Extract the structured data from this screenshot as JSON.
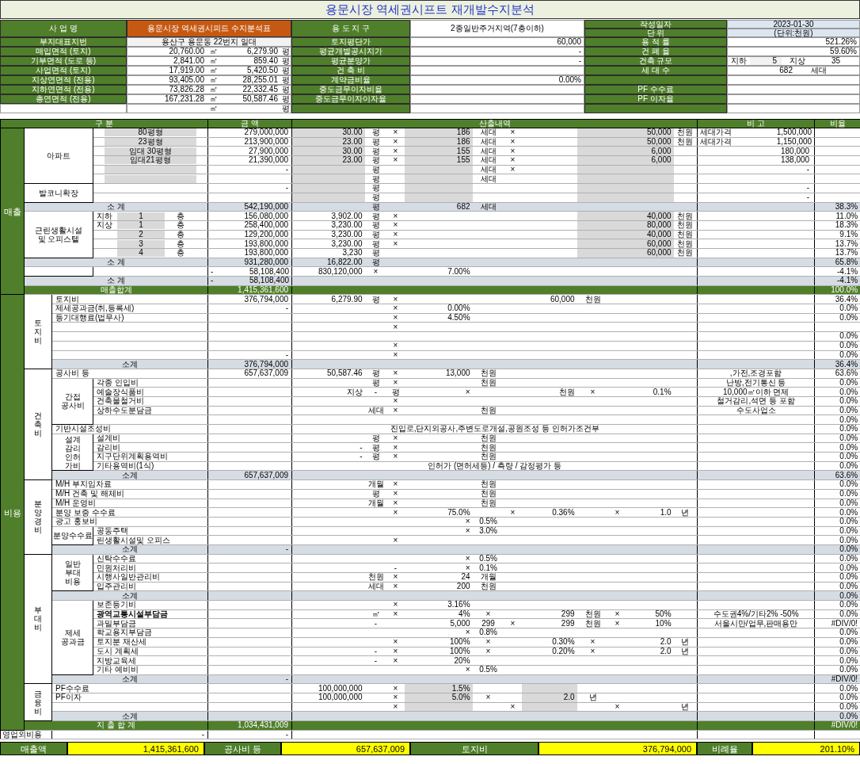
{
  "title": "용문시장 역세권시프트 재개발수지분석",
  "project": {
    "label": "사 업 명",
    "value": "용문시장 역세권시피드 수지분석표"
  },
  "zoning": {
    "label": "용 도 지 구",
    "value": "2종일반주거지역(7층이하)"
  },
  "date": {
    "label": "작성일자",
    "value": "2023-01-30"
  },
  "unit": {
    "label": "단 위",
    "value": "(단위:천원)"
  },
  "info_rows": [
    {
      "label": "부지대표지번",
      "text": "용산구 용문동 22번지 일대",
      "label2": "토지평단가",
      "value2": "60,000",
      "label3": "용 적 률",
      "value3": "521.26%"
    },
    {
      "label": "매입면적 (토지)",
      "sqm": "20,760.00",
      "sqm_unit": "㎡",
      "pyeong": "6,279.90",
      "pyeong_unit": "평",
      "label2": "평균개별공시지가",
      "value2": "-",
      "label3": "건 폐 율",
      "value3": "59.60%"
    },
    {
      "label": "기부면적 (도로 등)",
      "sqm": "2,841.00",
      "sqm_unit": "㎡",
      "pyeong": "859.40",
      "pyeong_unit": "평",
      "label2": "평균분양가",
      "value2": "-",
      "label3": "건축 규모",
      "scale": [
        "지하",
        "5",
        "지상",
        "35"
      ]
    },
    {
      "label": "사업면적 (토지)",
      "sqm": "17,919.00",
      "sqm_unit": "㎡",
      "pyeong": "5,420.50",
      "pyeong_unit": "평",
      "label2": "건 축 비",
      "label3": "세 대 수",
      "value3": "682",
      "value3_unit": "세대"
    },
    {
      "label": "지상연면적 (전용)",
      "sqm": "93,405.00",
      "sqm_unit": "㎡",
      "pyeong": "28,255.01",
      "pyeong_unit": "평",
      "label2": "계약금비율",
      "value2": "0.00%"
    },
    {
      "label": "지하연면적 (전용)",
      "sqm": "73,826.28",
      "sqm_unit": "㎡",
      "pyeong": "22,332.45",
      "pyeong_unit": "평",
      "label2": "중도금무이자비율",
      "label3": "PF 수수료"
    },
    {
      "label": "총연면적 (전용)",
      "sqm": "167,231.28",
      "sqm_unit": "㎡",
      "pyeong": "50,587.46",
      "pyeong_unit": "평",
      "label2": "중도금무이자이자율",
      "label3": "PF 이자율"
    },
    {
      "sqm_unit": "㎡",
      "pyeong_unit": "평"
    }
  ],
  "columns": [
    "구 분",
    "금 액",
    "산출내역",
    "비 고",
    "비율"
  ],
  "sections": [
    {
      "label": "매출",
      "children": [
        {
          "label": "아파트",
          "children": [
            {
              "kind": "unit",
              "label": "80평형",
              "amount": "279,000,000",
              "calc": {
                "column_1": "30.00",
                "column_2": "평",
                "column_3": "×",
                "column_4": "186",
                "column_5": "세대",
                "column_6": "×",
                "column_10": "50,000",
                "column_11": "천원"
              },
              "note": "세대가격",
              "note_value": "1,500,000"
            },
            {
              "kind": "unit",
              "label": "23평형",
              "amount": "213,900,000",
              "calc": {
                "column_1": "23.00",
                "column_2": "평",
                "column_3": "×",
                "column_4": "186",
                "column_5": "세대",
                "column_6": "×",
                "column_10": "50,000",
                "column_11": "천원"
              },
              "note": "세대가격",
              "note_value": "1,150,000"
            },
            {
              "kind": "unit",
              "label": "임대 30평형",
              "amount": "27,900,000",
              "calc": {
                "column_1": "30.00",
                "column_2": "평",
                "column_3": "×",
                "column_4": "155",
                "column_5": "세대",
                "column_6": "×",
                "column_10": "6,000"
              },
              "note_value": "180,000"
            },
            {
              "kind": "unit",
              "label": "임대21평형",
              "amount": "21,390,000",
              "calc": {
                "column_1": "23.00",
                "column_2": "평",
                "column_3": "×",
                "column_4": "155",
                "column_5": "세대",
                "column_6": "×",
                "column_10": "6,000"
              },
              "note_value": "138,000"
            },
            {
              "kind": "unit",
              "amount": "-",
              "calc": {
                "column_2": "평",
                "column_5": "세대",
                "column_6": "×"
              },
              "note_value": "-"
            },
            {
              "kind": "unit",
              "calc": {
                "column_2": "평",
                "column_5": "세대"
              }
            }
          ]
        },
        {
          "label": "발코니확장",
          "children": [
            {
              "kind": "input",
              "amount": "-",
              "calc": {
                "column_2": "평"
              },
              "note_value": "-"
            },
            {
              "kind": "input",
              "calc": {
                "column_2": "평"
              },
              "note_value": "-"
            }
          ]
        },
        {
          "kind": "subtotal",
          "label": "소 계",
          "amount": "542,190,000",
          "calc": {
            "column_2": "평",
            "column_4": "682",
            "column_5": "세대"
          },
          "ratio": "38.3%"
        },
        {
          "label": "근린생활시설\n및 오피스텔",
          "children": [
            {
              "kind": "floor",
              "prefix": "지하",
              "floor": "1",
              "suffix": "층",
              "amount": "156,080,000",
              "calc": {
                "column_1": "3,902.00",
                "column_2": "평",
                "column_3": "×",
                "column_10": "40,000",
                "column_11": "천원"
              },
              "ratio": "11.0%"
            },
            {
              "kind": "floor",
              "prefix": "지상",
              "floor": "1",
              "suffix": "층",
              "amount": "258,400,000",
              "calc": {
                "column_1": "3,230.00",
                "column_2": "평",
                "column_3": "×",
                "column_10": "80,000",
                "column_11": "천원"
              },
              "ratio": "18.3%"
            },
            {
              "kind": "floor",
              "floor": "2",
              "suffix": "층",
              "amount": "129,200,000",
              "calc": {
                "column_1": "3,230.00",
                "column_2": "평",
                "column_3": "×",
                "column_10": "40,000",
                "column_11": "천원"
              },
              "ratio": "9.1%"
            },
            {
              "kind": "floor",
              "floor": "3",
              "suffix": "층",
              "amount": "193,800,000",
              "calc": {
                "column_1": "3,230.00",
                "column_2": "평",
                "column_3": "×",
                "column_10": "60,000",
                "column_11": "천원"
              },
              "ratio": "13.7%"
            },
            {
              "kind": "floor",
              "floor": "4",
              "suffix": "층",
              "amount": "193,800,000",
              "calc": {
                "column_1": "3,230",
                "column_2": "평",
                "column_10": "60,000",
                "column_11": "천원"
              },
              "ratio": "13.7%"
            }
          ]
        },
        {
          "kind": "subtotal",
          "label": "소 계",
          "amount": "931,280,000",
          "calc": {
            "column_1": "16,822.00",
            "column_2": "평"
          },
          "ratio": "65.8%"
        },
        {
          "children": [
            {
              "sign": "-",
              "amount": "58,108,400",
              "calc": {
                "column_1": "830,120,000",
                "column_2": "×",
                "column_4": "7.00%"
              },
              "ratio": "-4.1%"
            }
          ]
        },
        {
          "kind": "subtotal",
          "label": "소 계",
          "sign": "-",
          "amount": "58,108,400",
          "ratio": "-4.1%"
        },
        {
          "kind": "total",
          "label": "매출합계",
          "amount": "1,415,361,600",
          "ratio": "100.0%"
        }
      ]
    },
    {
      "label": "비용",
      "children": [
        {
          "label": "토지비",
          "kind": "vertical",
          "children": [
            {
              "label": "토지비",
              "amount": "376,794,000",
              "calc": {
                "column_1": "6,279.90",
                "column_2": "평",
                "column_3": "×",
                "column_7": "60,000",
                "column_8": "천원"
              },
              "ratio": "36.4%"
            },
            {
              "label": "제세공과금(취,등록세)",
              "amount": "-",
              "calc": {
                "column_3": "×",
                "column_4": "0.00%"
              },
              "ratio": "0.0%"
            },
            {
              "label": "등기대행료(법무사)",
              "calc": {
                "column_3": "×",
                "column_4": "4.50%"
              },
              "ratio": "0.0%"
            },
            {
              "calc": {
                "column_3": "×"
              }
            },
            {
              "ratio": "0.0%"
            },
            {
              "calc": {
                "column_3": "×"
              },
              "ratio": "0.0%"
            },
            {
              "amount": "-",
              "calc": {
                "column_3": "×"
              },
              "ratio": "0.0%"
            },
            {
              "kind": "subtotal",
              "label": "소계",
              "amount": "376,794,000",
              "ratio": "36.4%"
            }
          ]
        },
        {
          "label": "건축비",
          "kind": "vertical",
          "children": [
            {
              "label": "공사비 등",
              "amount": "657,637,009",
              "calc": {
                "column_1": "50,587.46",
                "column_2": "평",
                "column_3": "×",
                "column_4": "13,000",
                "column_5": "천원"
              },
              "note": ",가전,조경포함",
              "ratio": "63.6%"
            },
            {
              "label": "간접\n공사비",
              "children": [
                {
                  "label": "각종 인입비",
                  "calc": {
                    "column_2": "평",
                    "column_3": "×",
                    "column_5": "천원"
                  },
                  "note": "난방,전기통신 등",
                  "ratio": "0.0%"
                },
                {
                  "label": "예술장식품비",
                  "calc": {
                    "column_1": "지상",
                    "column_2": "-",
                    "column_3": "평",
                    "column_4": "×",
                    "column_7": "천원",
                    "column_8": "×",
                    "column_10": "0.1%"
                  },
                  "note": "10,000㎡이하 면제",
                  "ratio": "0.0%"
                },
                {
                  "label": "건축물철거비",
                  "calc": {
                    "column_3": "×"
                  },
                  "note": "철거감리,석면 등 포함",
                  "ratio": "0.0%"
                },
                {
                  "label": "상하수도분담금",
                  "calc": {
                    "column_2": "세대",
                    "column_3": "×",
                    "column_5": "천원"
                  },
                  "note": "수도사업소",
                  "ratio": "0.0%"
                },
                {
                  "ratio": "0.0%"
                }
              ]
            },
            {
              "label": "기반시설조성비",
              "calc_text": "진입로,단지외공사,주변도로개설,공원조성 등 인허가조건부",
              "ratio": "0.0%"
            },
            {
              "label": "설계\n감리\n인허\n가비",
              "children": [
                {
                  "label": "설계비",
                  "calc": {
                    "column_2": "평",
                    "column_3": "×",
                    "column_5": "천원"
                  },
                  "ratio": "0.0%"
                },
                {
                  "label": "감리비",
                  "calc": {
                    "column_1": "-",
                    "column_2": "평",
                    "column_3": "×",
                    "column_5": "천원"
                  },
                  "ratio": "0.0%"
                },
                {
                  "label": "지구단위계획용역비",
                  "calc": {
                    "column_1": "-",
                    "column_2": "평",
                    "column_3": "×",
                    "column_5": "천원"
                  },
                  "ratio": "0.0%"
                },
                {
                  "label": "기타용역비(1식)",
                  "calc_text": "인허가 (면허세등) / 측량 / 감정평가 등",
                  "ratio": "0.0%"
                }
              ]
            },
            {
              "kind": "subtotal",
              "label": "소계",
              "amount": "657,637,009",
              "ratio": "63.6%"
            }
          ]
        },
        {
          "label": "분양경비",
          "kind": "vertical",
          "children": [
            {
              "label": "M/H 부지임차료",
              "calc": {
                "column_2": "개월",
                "column_3": "×",
                "column_5": "천원"
              },
              "ratio": "0.0%"
            },
            {
              "label": "M/H 건축 및 해체비",
              "calc": {
                "column_2": "평",
                "column_3": "×",
                "column_5": "천원"
              },
              "ratio": "0.0%"
            },
            {
              "label": "M/H 운영비",
              "calc": {
                "column_2": "개월",
                "column_3": "×",
                "column_5": "천원"
              },
              "ratio": "0.0%"
            },
            {
              "label": "분양 보증 수수료",
              "calc": {
                "column_3": "×",
                "column_4": "75.0%",
                "column_6": "×",
                "column_7": "0.36%",
                "column_9": "×",
                "column_10": "1.0",
                "column_11": "년"
              },
              "ratio": "0.0%"
            },
            {
              "label": "광고 홍보비",
              "calc": {
                "column_4": "×",
                "column_5": "0.5%"
              },
              "ratio": "0.0%"
            },
            {
              "label": "분양수수료",
              "children": [
                {
                  "label": "공동주택",
                  "calc": {
                    "column_4": "×",
                    "column_5": "3.0%"
                  },
                  "ratio": "0.0%"
                },
                {
                  "label": "린생활시설및 오피스",
                  "calc": {
                    "column_3": "×"
                  },
                  "ratio": "0.0%"
                }
              ]
            },
            {
              "kind": "subtotal",
              "label": "소계",
              "amount": "-",
              "ratio": "0.0%"
            }
          ]
        },
        {
          "label": "부대비",
          "kind": "vertical",
          "children": [
            {
              "label": "일반\n부대\n비용",
              "children": [
                {
                  "label": "신탁수수료",
                  "calc": {
                    "column_4": "×",
                    "column_5": "0.5%"
                  },
                  "ratio": "0.0%"
                },
                {
                  "label": "민원처리비",
                  "calc": {
                    "column_3": "-",
                    "column_4": "×",
                    "column_5": "0.1%"
                  },
                  "ratio": "0.0%"
                },
                {
                  "label": "시행사일반관리비",
                  "calc": {
                    "column_2": "천원",
                    "column_3": "×",
                    "column_4": "24",
                    "column_5": "개월"
                  },
                  "ratio": "0.0%"
                },
                {
                  "label": "입주관리비",
                  "calc": {
                    "column_2": "세대",
                    "column_3": "×",
                    "column_4": "200",
                    "column_5": "천원"
                  },
                  "ratio": "0.0%"
                }
              ]
            },
            {
              "kind": "subtotal",
              "label": "소계",
              "ratio": "0.0%"
            },
            {
              "label": "제세\n공과금",
              "children": [
                {
                  "label": "보존등기비",
                  "calc": {
                    "column_3": "×",
                    "column_4": "3.16%"
                  },
                  "ratio": "0.0%"
                },
                {
                  "label": "광역교통시설부담금",
                  "bold": true,
                  "calc": {
                    "column_2": "㎡",
                    "column_3": "×",
                    "column_4": "4%",
                    "column_5": "×",
                    "column_7": "299",
                    "column_8": "천원",
                    "column_9": "×",
                    "column_10": "50%"
                  },
                  "note": "수도권4%/기타2% -50%",
                  "ratio": "0.0%"
                },
                {
                  "label": "과밀부담금",
                  "calc": {
                    "column_2": "-",
                    "column_4": "5,000",
                    "column_5": "299",
                    "column_6": "×",
                    "column_7": "299",
                    "column_8": "천원",
                    "column_9": "×",
                    "column_10": "10%"
                  },
                  "note": "서울시만/업무,판매용만",
                  "ratio": "#DIV/0!"
                },
                {
                  "label": "학교용지부담금",
                  "calc": {
                    "column_4": "×",
                    "column_5": "0.8%"
                  },
                  "ratio": "0.0%"
                },
                {
                  "label": "토지분 재산세",
                  "calc": {
                    "column_3": "×",
                    "column_4": "100%",
                    "column_5": "×",
                    "column_7": "0.30%",
                    "column_8": "×",
                    "column_10": "2.0",
                    "column_11": "년"
                  },
                  "ratio": "0.0%"
                },
                {
                  "label": "도시 계획세",
                  "calc": {
                    "column_2": "-",
                    "column_3": "×",
                    "column_4": "100%",
                    "column_5": "×",
                    "column_7": "0.20%",
                    "column_8": "×",
                    "column_10": "2.0",
                    "column_11": "년"
                  },
                  "ratio": "0.0%"
                },
                {
                  "label": "지방교육세",
                  "calc": {
                    "column_2": "-",
                    "column_3": "×",
                    "column_4": "20%"
                  },
                  "ratio": "0.0%"
                },
                {
                  "label": "기타 예비비",
                  "calc": {
                    "column_4": "×",
                    "column_5": "0.5%"
                  },
                  "ratio": "0.0%"
                }
              ]
            },
            {
              "kind": "subtotal",
              "label": "소계",
              "amount": "-",
              "ratio": "#DIV/0!"
            }
          ]
        },
        {
          "label": "금융비",
          "kind": "vertical",
          "children": [
            {
              "kind": "finance",
              "label": "PF수수료",
              "calc": {
                "column_1": "100,000,000",
                "column_3": "×",
                "column_4": "1.5%"
              },
              "ratio": "0.0%"
            },
            {
              "kind": "finance",
              "label": "PF이자",
              "calc": {
                "column_1": "100,000,000",
                "column_3": "×",
                "column_4": "5.0%",
                "column_5": "×",
                "column_7": "2.0",
                "column_8": "년"
              },
              "ratio": "0.0%"
            },
            {
              "kind": "finance",
              "calc": {
                "column_3": "×",
                "column_6": "×",
                "column_9": "×",
                "column_11": "년"
              },
              "ratio": "0.0%"
            },
            {
              "kind": "subtotal",
              "label": "소계",
              "ratio": "0.0%"
            }
          ]
        },
        {
          "kind": "total",
          "label": "지 출 합 계",
          "amount": "1,034,431,009",
          "ratio": "#DIV/0!"
        }
      ]
    },
    {
      "kind": "other",
      "label": "영업외비용",
      "value": "-",
      "amount": "-"
    }
  ],
  "summary": [
    {
      "label": "매출액",
      "value": "1,415,361,600"
    },
    {
      "label": "공사비 등",
      "value": "657,637,009"
    },
    {
      "label": "토지비",
      "value": "376,794,000"
    },
    {
      "label": "비례율",
      "value": "201.10%"
    }
  ]
}
